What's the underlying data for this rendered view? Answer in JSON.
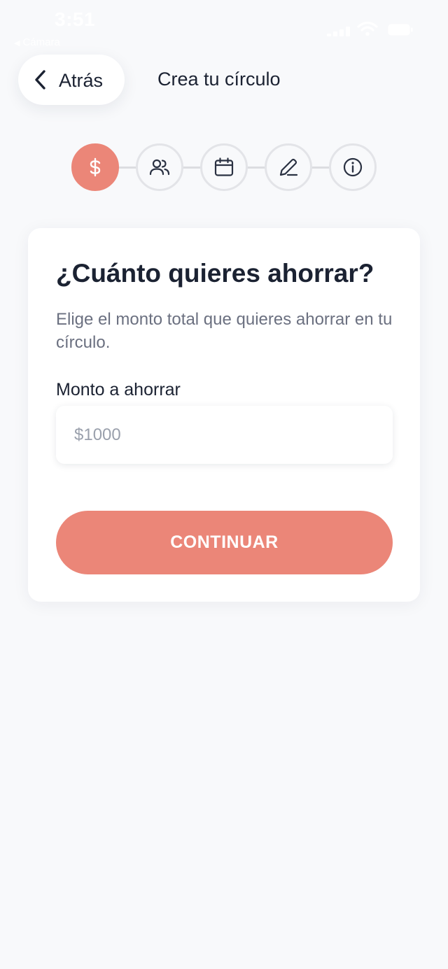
{
  "status_bar": {
    "time": "3:51",
    "back_app_label": "Cámara"
  },
  "header": {
    "back_label": "Atrás",
    "title": "Crea tu círculo"
  },
  "stepper": {
    "steps": [
      {
        "icon": "dollar-icon",
        "active": true
      },
      {
        "icon": "users-icon",
        "active": false
      },
      {
        "icon": "calendar-icon",
        "active": false
      },
      {
        "icon": "pencil-icon",
        "active": false
      },
      {
        "icon": "info-icon",
        "active": false
      }
    ]
  },
  "card": {
    "title": "¿Cuánto quieres ahorrar?",
    "subtitle": "Elige el monto total que quieres ahorrar en tu círculo.",
    "field_label": "Monto a ahorrar",
    "amount_value": "",
    "amount_placeholder": "$1000",
    "continue_label": "CONTINUAR"
  },
  "colors": {
    "accent": "#eb8678",
    "background": "#f8f9fb",
    "text_primary": "#1b2232",
    "text_secondary": "#6b7080"
  }
}
